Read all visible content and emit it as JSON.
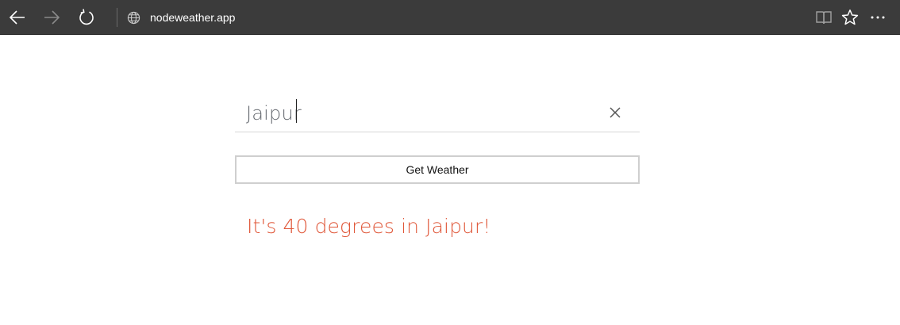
{
  "browser": {
    "url": "nodeweather.app",
    "icons": {
      "back": "back-arrow-icon",
      "forward": "forward-arrow-icon",
      "refresh": "refresh-icon",
      "site": "globe-icon",
      "reading_view": "reading-view-icon",
      "favorites": "star-icon",
      "more": "more-icon"
    }
  },
  "form": {
    "city_value": "Jaipur",
    "button_label": "Get Weather"
  },
  "result": {
    "message": "It's 40 degrees in Jaipur!"
  },
  "colors": {
    "toolbar": "#3b3b3b",
    "result_text": "#e0583a"
  }
}
